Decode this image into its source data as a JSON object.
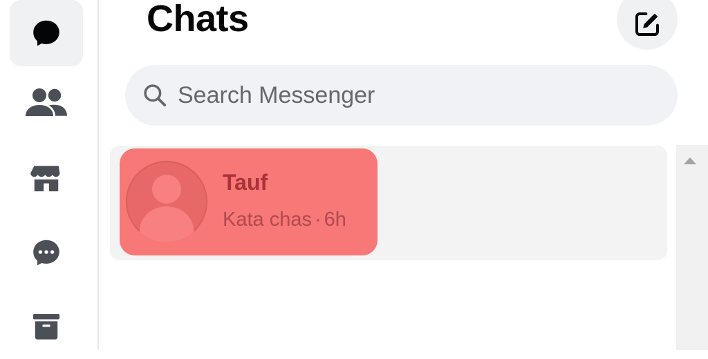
{
  "header": {
    "title": "Chats"
  },
  "rail": {
    "items": [
      {
        "name": "chats",
        "icon": "chat-bubble-icon",
        "active": true
      },
      {
        "name": "people",
        "icon": "people-icon",
        "active": false
      },
      {
        "name": "marketplace",
        "icon": "store-icon",
        "active": false
      },
      {
        "name": "requests",
        "icon": "chat-dots-icon",
        "active": false
      },
      {
        "name": "archived",
        "icon": "archive-icon",
        "active": false
      }
    ]
  },
  "compose": {
    "icon": "compose-icon"
  },
  "search": {
    "placeholder": "Search Messenger",
    "value": ""
  },
  "chats": [
    {
      "name": "Tauf",
      "preview": "Kata chas",
      "separator": "·",
      "time": "6h",
      "highlighted": true,
      "highlight_color": "#f87777"
    }
  ],
  "colors": {
    "icon": "#4b4f56",
    "search_bg": "#f0f2f5",
    "active_rail_bg": "#f0f1f3"
  }
}
